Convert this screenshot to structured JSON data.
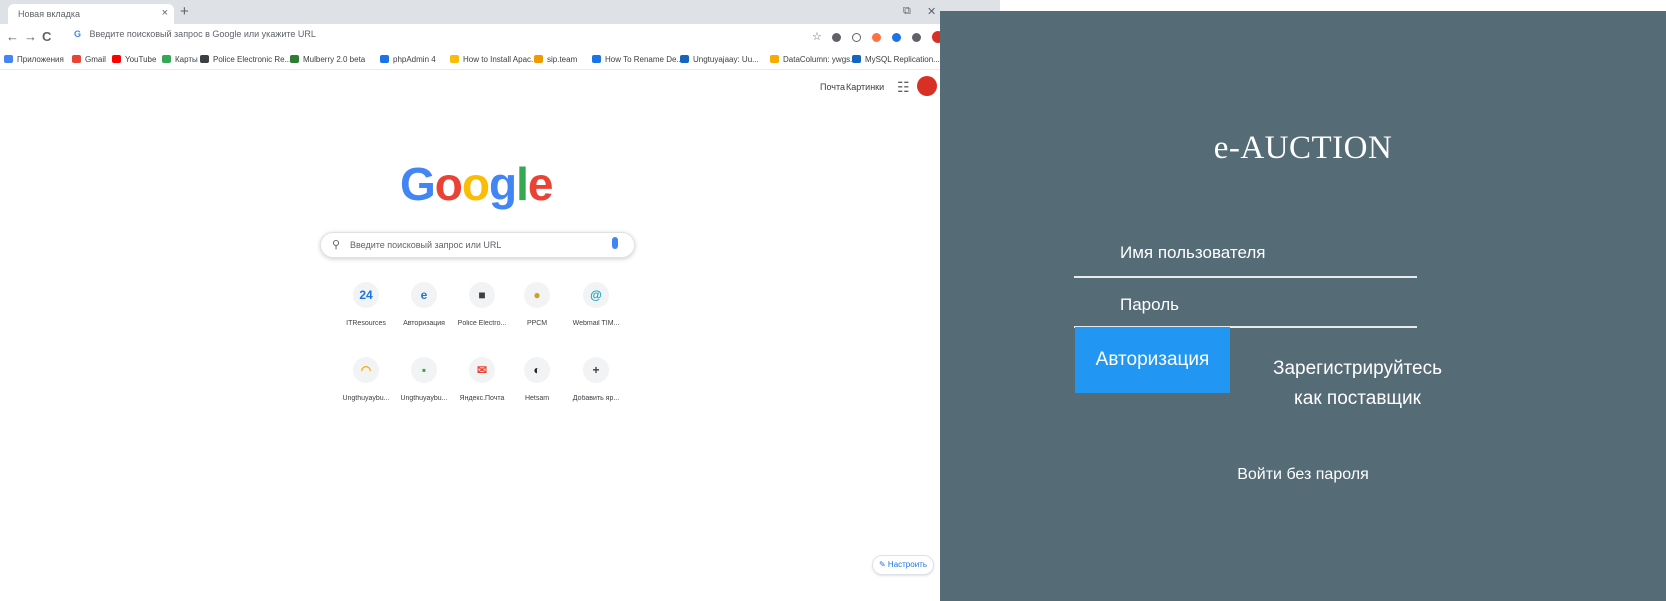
{
  "browser": {
    "tab_title": "Новая вкладка",
    "tab_close": "×",
    "new_tab": "+",
    "win_restore": "⧉",
    "win_close": "✕",
    "address_placeholder": "Введите поисковый запрос в Google или укажите URL",
    "bookmarks": [
      {
        "label": "Приложения",
        "color": "#4285f4"
      },
      {
        "label": "Gmail",
        "color": "#ea4335"
      },
      {
        "label": "YouTube",
        "color": "#ff0000"
      },
      {
        "label": "Карты",
        "color": "#34a853"
      },
      {
        "label": "Police Electronic Re...",
        "color": "#3c4043"
      },
      {
        "label": "Mulberry 2.0 beta",
        "color": "#2e7d32"
      },
      {
        "label": "phpAdmin 4",
        "color": "#1a73e8"
      },
      {
        "label": "How to Install Apac...",
        "color": "#fbbc04"
      },
      {
        "label": "sip.team",
        "color": "#f29900"
      },
      {
        "label": "How To Rename De...",
        "color": "#1a73e8"
      },
      {
        "label": "Ungtuyajaay: Uu...",
        "color": "#1565c0"
      },
      {
        "label": "DataColumn: ywgs...",
        "color": "#f9ab00"
      },
      {
        "label": "MySQL Replication...",
        "color": "#1565c0"
      }
    ],
    "bookmarks_more": "»",
    "extension_colors": [
      "#5f6368",
      "#5f6368",
      "#ff7043",
      "#1a73e8",
      "#5f6368",
      "#d93025"
    ]
  },
  "newtab": {
    "gmail_link": "Почта",
    "images_link": "Картинки",
    "logo_letters": [
      {
        "ch": "G",
        "color": "#4285f4"
      },
      {
        "ch": "o",
        "color": "#ea4335"
      },
      {
        "ch": "o",
        "color": "#fbbc05"
      },
      {
        "ch": "g",
        "color": "#4285f4"
      },
      {
        "ch": "l",
        "color": "#34a853"
      },
      {
        "ch": "e",
        "color": "#ea4335"
      }
    ],
    "search_placeholder": "Введите поисковый запрос или URL",
    "shortcuts": [
      {
        "label": "ITResources",
        "glyph": "24",
        "color": "#1a73e8"
      },
      {
        "label": "Авторизация",
        "glyph": "e",
        "color": "#1976d2"
      },
      {
        "label": "Police Electro...",
        "glyph": "■",
        "color": "#3c4043"
      },
      {
        "label": "РРСМ",
        "glyph": "●",
        "color": "#c9a227"
      },
      {
        "label": "Webmail TIM...",
        "glyph": "@",
        "color": "#12a4b8"
      },
      {
        "label": "Ungthuyaybu...",
        "glyph": "◠",
        "color": "#f9ab00"
      },
      {
        "label": "Ungthuyaybu...",
        "glyph": "▪",
        "color": "#34a853"
      },
      {
        "label": "Яндекс.Почта",
        "glyph": "✉",
        "color": "#ea4335"
      },
      {
        "label": "Hetsam",
        "glyph": "◐",
        "color": "#202124"
      },
      {
        "label": "Добавить яр...",
        "glyph": "+",
        "color": "#3c4043"
      }
    ],
    "customize_label": "✎ Настроить"
  },
  "auction": {
    "brand": "e-AUCTION",
    "username_placeholder": "Имя пользователя",
    "password_placeholder": "Пароль",
    "login_button": "Авторизация",
    "register_line1": "Зарегистрируйтесь",
    "register_line2": "как поставщик",
    "passwordless_link": "Войти без пароля",
    "panel_color": "#556b76",
    "accent_color": "#2196f3"
  }
}
